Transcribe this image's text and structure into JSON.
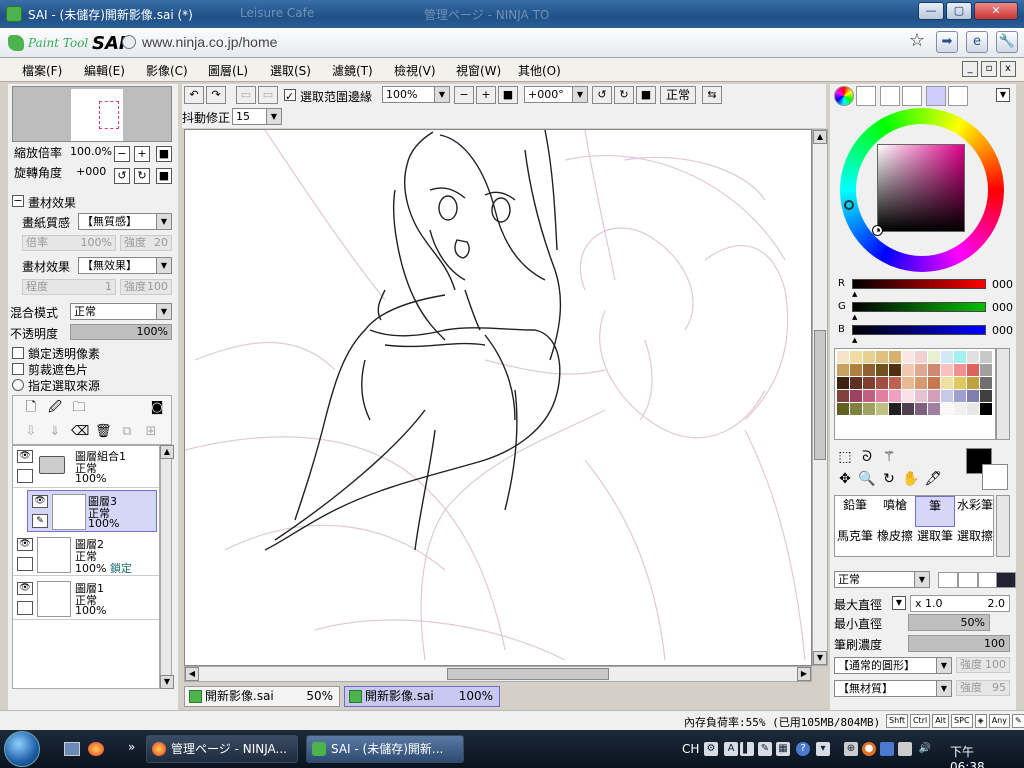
{
  "window": {
    "title": "SAI - (未儲存)開新影像.sai (*)",
    "ghost_tab_1": "Leisure Cafe",
    "ghost_tab_2": "管理ページ - NINJA TO",
    "minimize": "—",
    "maximize": "▢",
    "close": "✕"
  },
  "browser": {
    "logo_text": "Paint Tool",
    "logo_sai": "SAI",
    "url": "www.ninja.co.jp/home",
    "star_icon": "☆",
    "go_icon": "➡",
    "page_icon": "e",
    "tools_icon": "🔧"
  },
  "menu": {
    "items": [
      "檔案(F)",
      "編輯(E)",
      "影像(C)",
      "圖層(L)",
      "選取(S)",
      "濾鏡(T)",
      "檢視(V)",
      "視窗(W)",
      "其他(O)"
    ]
  },
  "navigator": {
    "zoom_label": "縮放倍率",
    "zoom_value": "100.0%",
    "rotate_label": "旋轉角度",
    "rotate_value": "+000"
  },
  "material": {
    "section_label": "畫材效果",
    "paper_label": "畫紙質感",
    "paper_value": "【無質感】",
    "scale_label": "倍率",
    "scale_value": "100%",
    "strength_label": "強度",
    "strength_value": "20",
    "effect_label": "畫材效果",
    "effect_value": "【無效果】",
    "degree_label": "程度",
    "degree_value": "1",
    "strength2_label": "強度",
    "strength2_value": "100"
  },
  "layer_props": {
    "blend_label": "混合模式",
    "blend_value": "正常",
    "opacity_label": "不透明度",
    "opacity_value": "100%",
    "lock_alpha": "鎖定透明像素",
    "clip_mask": "剪裁遮色片",
    "sel_source": "指定選取來源"
  },
  "layers": [
    {
      "name": "圖層組合1",
      "mode": "正常",
      "opacity": "100%",
      "lock": ""
    },
    {
      "name": "圖層3",
      "mode": "正常",
      "opacity": "100%",
      "lock": ""
    },
    {
      "name": "圖層2",
      "mode": "正常",
      "opacity": "100%",
      "lock": "鎖定"
    },
    {
      "name": "圖層1",
      "mode": "正常",
      "opacity": "100%",
      "lock": ""
    }
  ],
  "canvas_toolbar": {
    "sel_edge_label": "選取范圍邊緣",
    "zoom_value": "100%",
    "angle_value": "+000°",
    "mode_button": "正常",
    "stab_label": "抖動修正",
    "stab_value": "15"
  },
  "doc_tabs": [
    {
      "name": "開新影像.sai",
      "zoom": "50%"
    },
    {
      "name": "開新影像.sai",
      "zoom": "100%"
    }
  ],
  "color": {
    "r_label": "R",
    "r_value": "000",
    "g_label": "G",
    "g_value": "000",
    "b_label": "B",
    "b_value": "000",
    "r_color": "#ff0000",
    "g_color": "#00c000",
    "b_color": "#0000ff",
    "swatches": [
      "#f4e4c8",
      "#f0dca0",
      "#e8d090",
      "#e0c080",
      "#d8b070",
      "#f8e8e0",
      "#f0d0d0",
      "#e8f0d0",
      "#d0e8f8",
      "#a0f0f0",
      "#e0e0e0",
      "#c8c8c8",
      "#c8a060",
      "#b08040",
      "#906030",
      "#705020",
      "#503010",
      "#f0c8b0",
      "#e0a890",
      "#d08870",
      "#f8c0c0",
      "#f09090",
      "#e06060",
      "#a0a0a0",
      "#402010",
      "#603020",
      "#804030",
      "#a05040",
      "#c06050",
      "#e8b890",
      "#d89870",
      "#c87850",
      "#f0e0a0",
      "#e0c860",
      "#c0a040",
      "#707070",
      "#804040",
      "#a04060",
      "#c06080",
      "#e080a0",
      "#f0a0c0",
      "#fce0e8",
      "#e8c0d0",
      "#d0a0b8",
      "#c8c8e8",
      "#a0a0d0",
      "#8080b0",
      "#404040",
      "#606020",
      "#808040",
      "#a0a060",
      "#c0c080",
      "#202020",
      "#504050",
      "#806080",
      "#a080a0",
      "#f8f8f8",
      "#f0f0f0",
      "#e8e8e8",
      "#000000"
    ]
  },
  "brushes": {
    "row1": [
      "鉛筆",
      "噴槍",
      "筆",
      "水彩筆"
    ],
    "row2": [
      "馬克筆",
      "橡皮擦",
      "選取筆",
      "選取擦"
    ],
    "mode_value": "正常",
    "max_size_label": "最大直徑",
    "max_size_mult": "x 1.0",
    "max_size_value": "2.0",
    "min_size_label": "最小直徑",
    "min_size_value": "50%",
    "density_label": "筆刷濃度",
    "density_value": "100",
    "shape_value": "【通常的圓形】",
    "shape_strength_label": "強度",
    "shape_strength_value": "100",
    "texture_value": "【無材質】",
    "texture_strength_label": "強度",
    "texture_strength_value": "95"
  },
  "status": {
    "memory": "內存負荷率:55% (已用105MB/804MB)",
    "keys": [
      "Shft",
      "Ctrl",
      "Alt",
      "SPC",
      "◈",
      "Any",
      "✎"
    ]
  },
  "taskbar": {
    "task1": "管理ページ - NINJA...",
    "task2": "SAI - (未儲存)開新...",
    "lang": "CH",
    "clock": "下午 06:38",
    "chevron": "»"
  }
}
